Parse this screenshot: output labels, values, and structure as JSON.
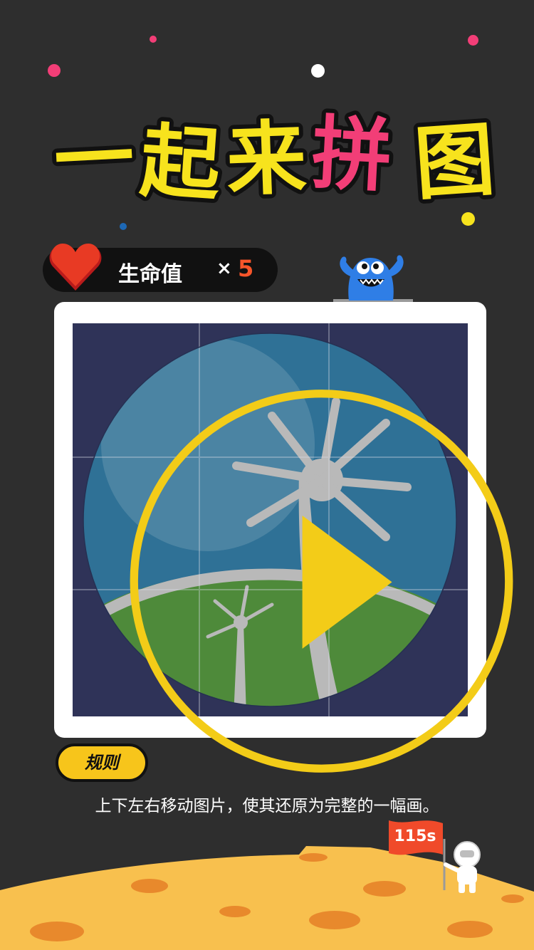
{
  "title": {
    "chars": [
      "一",
      "起",
      "来",
      "拼",
      "图"
    ],
    "primary_color": "#f7e31d",
    "accent_color": "#f23e77"
  },
  "lives": {
    "label": "生命值",
    "multiplier": "×",
    "count": "5",
    "icon": "heart-icon"
  },
  "puzzle": {
    "grid_rows": 3,
    "grid_cols": 3,
    "play_icon": "play-icon",
    "ring_color": "#f3cc18"
  },
  "rules": {
    "button_label": "规则",
    "instruction": "上下左右移动图片，使其还原为完整的一幅画。"
  },
  "timer": {
    "value": "115s",
    "flag_color": "#f04a2a"
  }
}
